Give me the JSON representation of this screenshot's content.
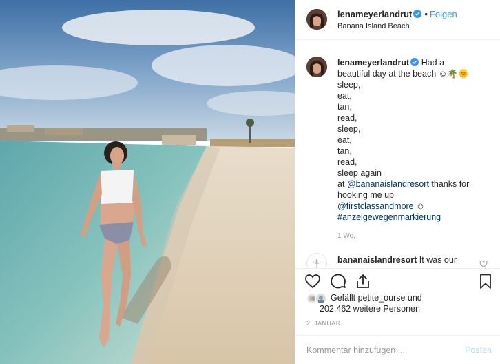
{
  "header": {
    "username": "lenameyerlandrut",
    "dot": "•",
    "follow_label": "Folgen",
    "location": "Banana Island Beach"
  },
  "caption": {
    "username": "lenameyerlandrut",
    "lines": [
      "Had a",
      "beautiful day at the beach ☺🌴🌞",
      "sleep,",
      "eat,",
      "tan,",
      "read,",
      "sleep,",
      "eat,",
      "tan,",
      "read,",
      "sleep again"
    ],
    "at_prefix": "at ",
    "mention": "@bananaislandresort",
    "thanks_text": " thanks for",
    "thanks_text2": "hooking me up",
    "mention2": "@firstclassandmore",
    "smile": " ☺",
    "hashtag": "#anzeigewegenmarkierung",
    "time_ago": "1 Wo."
  },
  "reply": {
    "username": "bananaislandresort",
    "text": " It was our"
  },
  "likes": {
    "line1": "Gefällt petite_ourse und",
    "line2": "202.462 weitere Personen"
  },
  "post_date": "2. JANUAR",
  "comment": {
    "placeholder": "Kommentar hinzufügen ...",
    "post_label": "Posten"
  },
  "icons": {
    "like": "heart-icon",
    "comment": "speech-bubble-icon",
    "share": "share-icon",
    "save": "bookmark-icon",
    "verified": "verified-badge-icon"
  },
  "colors": {
    "link": "#003569",
    "follow": "#3897f0",
    "verified": "#3897f0",
    "post_disabled": "#b2dffc"
  }
}
